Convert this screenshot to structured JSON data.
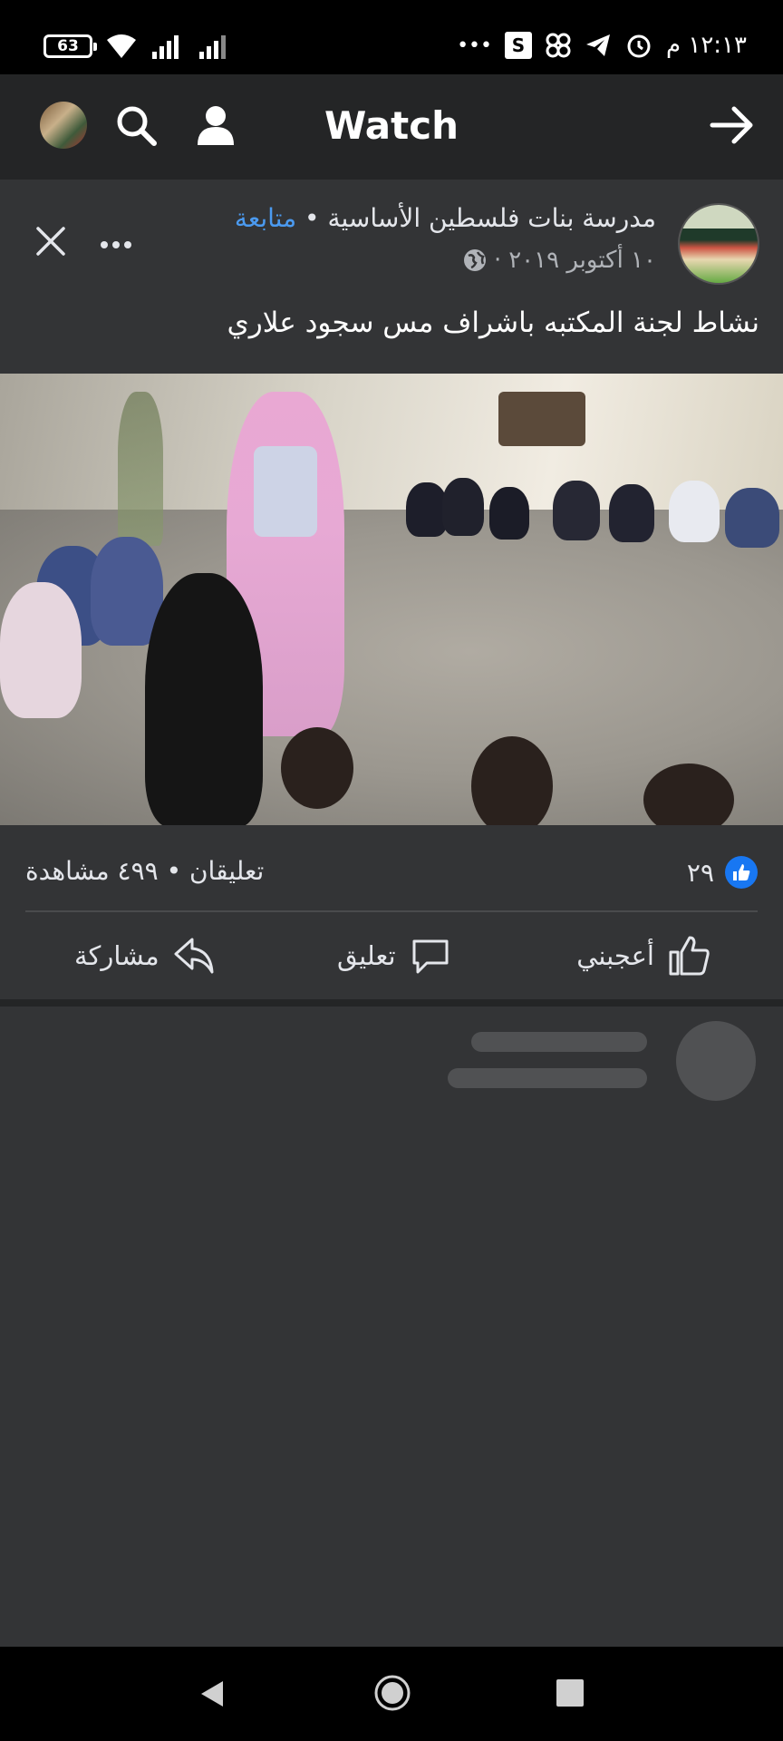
{
  "status_bar": {
    "battery": "63",
    "time": "١٢:١٣ م",
    "s_label": "S",
    "more": "•••"
  },
  "header": {
    "title": "Watch"
  },
  "post": {
    "page_name": "مدرسة بنات فلسطين الأساسية",
    "separator": "•",
    "follow_label": "متابعة",
    "date": "١٠ أكتوبر ٢٠١٩",
    "date_separator": "·",
    "caption": "نشاط لجنة المكتبه باشراف مس سجود علاري"
  },
  "stats": {
    "likes_count": "٢٩",
    "comments_and_views": "تعليقان • ٤٩٩ مشاهدة"
  },
  "actions": {
    "like": "أعجبني",
    "comment": "تعليق",
    "share": "مشاركة"
  },
  "colors": {
    "accent": "#1877f2",
    "follow": "#4b9af0",
    "background": "#333436",
    "header": "#242526"
  }
}
